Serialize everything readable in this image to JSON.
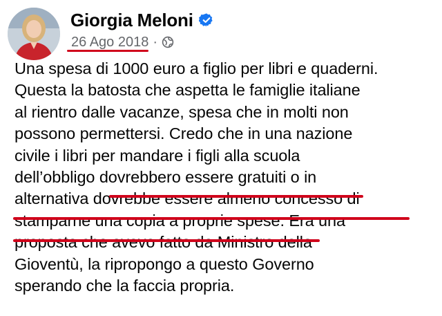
{
  "post": {
    "author_name": "Giorgia Meloni",
    "verified_icon": "verified-badge-icon",
    "date": "26 Ago 2018",
    "separator": "·",
    "audience_icon": "globe-icon",
    "accent_color": "#1877f2",
    "highlight_color": "#d0021b",
    "lines": [
      "Una spesa di 1000 euro a figlio per libri e quaderni.",
      "Questa la batosta che aspetta le famiglie italiane",
      "al rientro dalle vacanze, spesa che in molti non",
      "possono permettersi. Credo che in una nazione",
      "civile i libri per mandare i figli alla scuola",
      "dell’obbligo dovrebbero essere gratuiti o in",
      "alternativa dovrebbe essere almeno concesso di",
      "stamparne una copia a proprie spese. Era una",
      "proposta che avevo fatto da Ministro della",
      "Gioventù, la ripropongo a questo Governo",
      "sperando che la faccia propria."
    ]
  }
}
